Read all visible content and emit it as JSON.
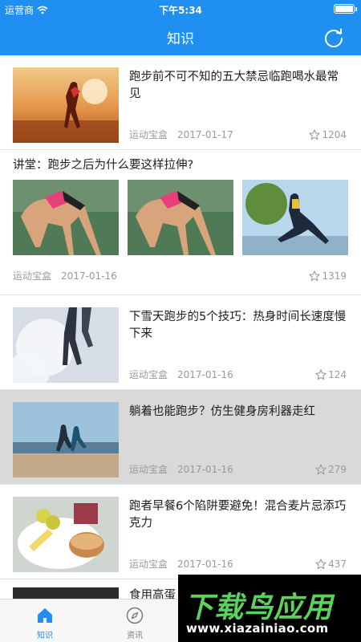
{
  "status_bar": {
    "carrier": "运营商",
    "time": "下午5:34"
  },
  "nav": {
    "title": "知识"
  },
  "feed": [
    {
      "title": "跑步前不可不知的五大禁忌临跑喝水最常见",
      "source": "运动宝盒",
      "date": "2017-01-17",
      "favorites": "1204"
    },
    {
      "title": "讲堂：跑步之后为什么要这样拉伸?",
      "source": "运动宝盒",
      "date": "2017-01-16",
      "favorites": "1319"
    },
    {
      "title": "下雪天跑步的5个技巧：热身时间长速度慢下来",
      "source": "运动宝盒",
      "date": "2017-01-16",
      "favorites": "124"
    },
    {
      "title": "躺着也能跑步？仿生健身房利器走红",
      "source": "运动宝盒",
      "date": "2017-01-16",
      "favorites": "279"
    },
    {
      "title": "跑者早餐6个陷阱要避免！混合麦片忌添巧克力",
      "source": "运动宝盒",
      "date": "2017-01-16",
      "favorites": "437"
    },
    {
      "title": "食用高蛋"
    }
  ],
  "tabs": [
    {
      "label": "知识",
      "icon": "home-icon",
      "active": true
    },
    {
      "label": "资讯",
      "icon": "compass-icon",
      "active": false
    }
  ],
  "watermark": {
    "brand": "下载鸟应用",
    "url": "www.xiazainiao.com"
  },
  "colors": {
    "primary": "#1f8ff2",
    "muted": "#9a9a9a"
  }
}
